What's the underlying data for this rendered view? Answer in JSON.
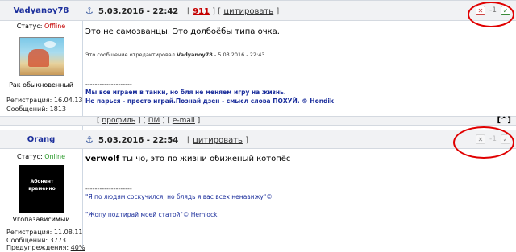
{
  "post1": {
    "username": "Vadyanoy78",
    "date": "5.03.2016 - 22:42",
    "post_number": "911",
    "quote_label": "цитировать",
    "status_label": "Статус:",
    "status_value": "Offline",
    "user_title": "Рак обыкновенный",
    "reg_label": "Регистрация: 16.04.13",
    "msg_label": "Сообщений: 1813",
    "vote_count": "-1",
    "message": "Это не самозванцы. Это долбоёбы типа очка.",
    "edited_prefix": "Это сообщение отредактировал",
    "edited_user": "Vadyanoy78",
    "edited_time": "- 5.03.2016 - 22:43",
    "separator": "--------------------",
    "sig_line1": "Мы все играем в танки, но бля не меняем игру на жизнь.",
    "sig_line2": "Не парься - просто играй.Познай дзен - смысл слова ПОХУЙ. © Hondik"
  },
  "footer": {
    "profile": "профиль",
    "pm": "ПМ",
    "email": "e-mail",
    "top": "^"
  },
  "post2": {
    "username": "Orang",
    "date": "5.03.2016 - 22:54",
    "quote_label": "цитировать",
    "status_label": "Статус:",
    "status_value": "Online",
    "avatar_text1": "Абонент",
    "avatar_text2": "временно",
    "user_title": "Vгопазависимый",
    "reg_label": "Регистрация: 11.08.11",
    "msg_label": "Сообщений: 3773",
    "warn_label": "Предупреждения:",
    "warn_value": "40%",
    "vote_count": "-1",
    "message_bold": "verwolf",
    "message_rest": " ты чо, это по жизни обиженый котопёс",
    "separator": "--------------------",
    "sig_line1": "\"Я по людям соскучился, но блядь я вас всех ненавижу\"©",
    "sig_line2": "\"Жопу подтирай моей статой\"© Hemlock"
  },
  "colors": {
    "accent": "#1c2f9c",
    "offline": "#c40000",
    "online": "#2a9a2a",
    "header_bg": "#f1f2f4",
    "annotation": "#e00000"
  }
}
